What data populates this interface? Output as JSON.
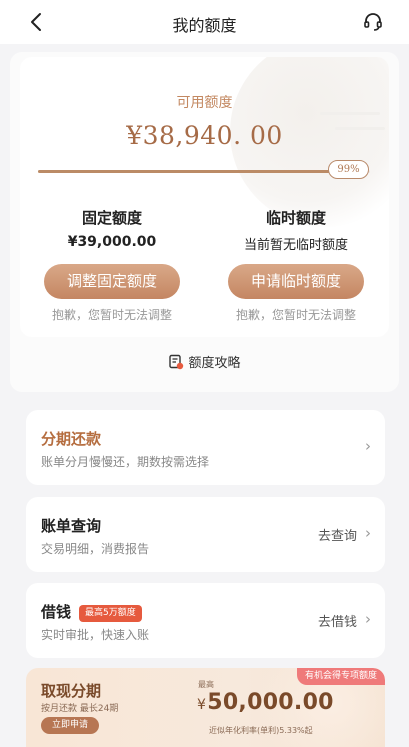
{
  "nav": {
    "title": "我的额度"
  },
  "quota": {
    "available_label": "可用额度",
    "available_amount": "¥38,940. 00",
    "progress_percent_text": "99%",
    "progress_fraction": 0.99,
    "fixed": {
      "title": "固定额度",
      "value": "¥39,000.00",
      "button": "调整固定额度",
      "note": "抱歉，您暂时无法调整"
    },
    "temp": {
      "title": "临时额度",
      "value": "当前暂无临时额度",
      "button": "申请临时额度",
      "note": "抱歉，您暂时无法调整"
    },
    "strategy_label": "额度攻略"
  },
  "menu": {
    "installment": {
      "title": "分期还款",
      "sub": "账单分月慢慢还，期数按需选择"
    },
    "bill": {
      "title": "账单查询",
      "sub": "交易明细，消费报告",
      "action": "去查询"
    },
    "borrow": {
      "title": "借钱",
      "badge": "最高5万额度",
      "sub": "实时审批，快速入账",
      "action": "去借钱"
    }
  },
  "cash": {
    "title": "取现分期",
    "sub": "按月还款 最长24期",
    "apply": "立即申请",
    "max_label": "最高",
    "yen": "¥",
    "amount": "50,000.00",
    "rate": "近似年化利率(单利)5.33%起",
    "tag": "有机会得专项额度"
  },
  "colors": {
    "accent": "#c48662",
    "brand_text": "#a66b47",
    "badge_red": "#e65a3e"
  },
  "icons": [
    "back-icon",
    "customer-service-icon",
    "strategy-doc-icon",
    "chevron-right-icon"
  ]
}
